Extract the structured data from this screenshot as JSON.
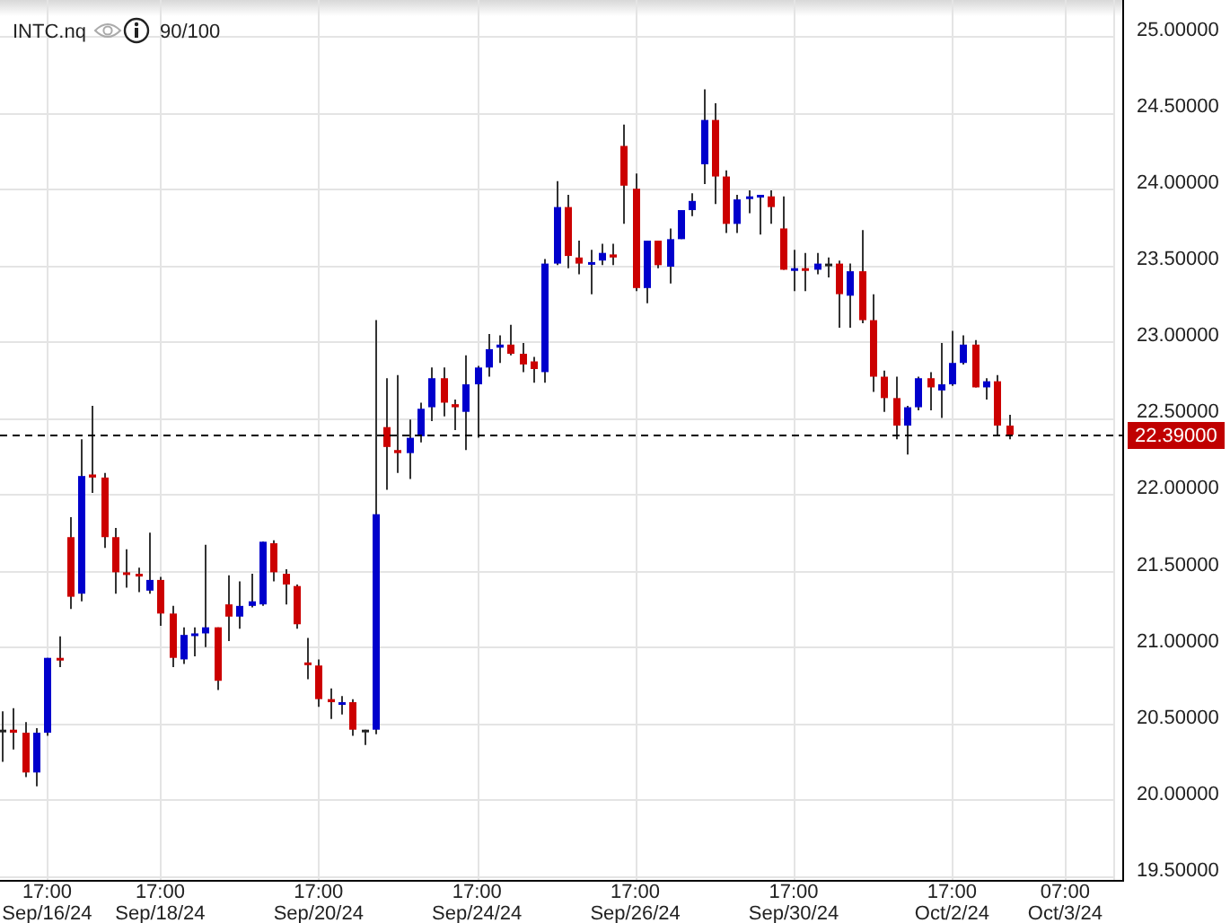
{
  "header": {
    "symbol": "INTC.nq",
    "score": "90/100"
  },
  "chart": {
    "chart_data": {
      "type": "candlestick",
      "grid": true,
      "ylim": [
        19.477,
        25.235
      ],
      "categories": [
        null,
        null,
        null,
        null,
        "17:00 Sep/16/24",
        null,
        null,
        null,
        null,
        null,
        null,
        null,
        null,
        null,
        "17:00 Sep/18/24",
        null,
        null,
        null,
        null,
        null,
        null,
        null,
        null,
        null,
        null,
        null,
        null,
        null,
        "17:00 Sep/20/24",
        null,
        null,
        null,
        null,
        null,
        null,
        null,
        null,
        null,
        null,
        null,
        null,
        null,
        "17:00 Sep/24/24",
        null,
        null,
        null,
        null,
        null,
        null,
        null,
        null,
        null,
        null,
        null,
        null,
        null,
        "17:00 Sep/26/24",
        null,
        null,
        null,
        null,
        null,
        null,
        null,
        null,
        null,
        null,
        null,
        null,
        null,
        "17:00 Sep/30/24",
        null,
        null,
        null,
        null,
        null,
        null,
        null,
        null,
        null,
        null,
        null,
        null,
        null,
        "17:00 Oct/2/24",
        null,
        null,
        null,
        null,
        null,
        null,
        null,
        null,
        null,
        "07:00 Oct/3/24"
      ],
      "ohlc": [
        [
          20.46,
          20.58,
          20.25,
          20.46
        ],
        [
          20.46,
          20.6,
          20.33,
          20.44
        ],
        [
          20.44,
          20.51,
          20.15,
          20.18
        ],
        [
          20.18,
          20.47,
          20.09,
          20.44
        ],
        [
          20.44,
          20.93,
          20.42,
          20.93
        ],
        [
          20.93,
          21.07,
          20.87,
          20.92
        ],
        [
          21.72,
          21.85,
          21.25,
          21.33
        ],
        [
          21.35,
          22.36,
          21.3,
          22.12
        ],
        [
          22.13,
          22.58,
          22.01,
          22.11
        ],
        [
          22.11,
          22.14,
          21.65,
          21.72
        ],
        [
          21.72,
          21.78,
          21.35,
          21.49
        ],
        [
          21.49,
          21.64,
          21.39,
          21.48
        ],
        [
          21.48,
          21.52,
          21.36,
          21.47
        ],
        [
          21.37,
          21.75,
          21.35,
          21.44
        ],
        [
          21.44,
          21.46,
          21.14,
          21.22
        ],
        [
          21.22,
          21.27,
          20.87,
          20.93
        ],
        [
          20.92,
          21.13,
          20.89,
          21.08
        ],
        [
          21.08,
          21.13,
          20.94,
          21.09
        ],
        [
          21.09,
          21.67,
          21.0,
          21.13
        ],
        [
          21.13,
          21.13,
          20.72,
          20.78
        ],
        [
          21.28,
          21.47,
          21.04,
          21.2
        ],
        [
          21.2,
          21.43,
          21.12,
          21.27
        ],
        [
          21.27,
          21.48,
          21.26,
          21.3
        ],
        [
          21.28,
          21.69,
          21.27,
          21.69
        ],
        [
          21.68,
          21.7,
          21.43,
          21.49
        ],
        [
          21.48,
          21.51,
          21.28,
          21.41
        ],
        [
          21.4,
          21.41,
          21.12,
          21.15
        ],
        [
          20.9,
          21.06,
          20.79,
          20.89
        ],
        [
          20.88,
          20.92,
          20.61,
          20.66
        ],
        [
          20.66,
          20.73,
          20.53,
          20.64
        ],
        [
          20.63,
          20.68,
          20.56,
          20.64
        ],
        [
          20.64,
          20.66,
          20.42,
          20.46
        ],
        [
          20.46,
          20.46,
          20.36,
          20.46
        ],
        [
          20.46,
          23.14,
          20.43,
          21.87
        ],
        [
          22.44,
          22.76,
          22.03,
          22.31
        ],
        [
          22.29,
          22.78,
          22.14,
          22.27
        ],
        [
          22.27,
          22.49,
          22.1,
          22.37
        ],
        [
          22.38,
          22.6,
          22.34,
          22.56
        ],
        [
          22.57,
          22.83,
          22.48,
          22.76
        ],
        [
          22.76,
          22.83,
          22.51,
          22.6
        ],
        [
          22.59,
          22.62,
          22.42,
          22.57
        ],
        [
          22.54,
          22.91,
          22.29,
          22.72
        ],
        [
          22.72,
          22.84,
          22.37,
          22.83
        ],
        [
          22.83,
          23.05,
          22.77,
          22.95
        ],
        [
          22.96,
          23.04,
          22.86,
          22.98
        ],
        [
          22.98,
          23.11,
          22.91,
          22.92
        ],
        [
          22.92,
          22.99,
          22.8,
          22.85
        ],
        [
          22.87,
          22.9,
          22.73,
          22.82
        ],
        [
          22.8,
          23.54,
          22.73,
          23.51
        ],
        [
          23.51,
          24.05,
          23.5,
          23.88
        ],
        [
          23.88,
          23.96,
          23.48,
          23.56
        ],
        [
          23.55,
          23.66,
          23.44,
          23.51
        ],
        [
          23.51,
          23.6,
          23.31,
          23.52
        ],
        [
          23.53,
          23.64,
          23.5,
          23.58
        ],
        [
          23.57,
          23.64,
          23.5,
          23.55
        ],
        [
          24.28,
          24.42,
          23.77,
          24.02
        ],
        [
          24.0,
          24.1,
          23.33,
          23.35
        ],
        [
          23.35,
          23.66,
          23.25,
          23.66
        ],
        [
          23.66,
          23.66,
          23.48,
          23.5
        ],
        [
          23.49,
          23.74,
          23.38,
          23.67
        ],
        [
          23.67,
          23.86,
          23.67,
          23.86
        ],
        [
          23.86,
          23.97,
          23.82,
          23.92
        ],
        [
          24.16,
          24.65,
          24.03,
          24.45
        ],
        [
          24.45,
          24.56,
          23.9,
          24.08
        ],
        [
          24.08,
          24.12,
          23.71,
          23.77
        ],
        [
          23.77,
          23.96,
          23.71,
          23.93
        ],
        [
          23.94,
          23.99,
          23.84,
          23.95
        ],
        [
          23.95,
          23.96,
          23.7,
          23.96
        ],
        [
          23.95,
          23.99,
          23.77,
          23.88
        ],
        [
          23.74,
          23.95,
          23.47,
          23.47
        ],
        [
          23.47,
          23.6,
          23.33,
          23.48
        ],
        [
          23.48,
          23.58,
          23.33,
          23.47
        ],
        [
          23.47,
          23.58,
          23.44,
          23.51
        ],
        [
          23.51,
          23.55,
          23.42,
          23.51
        ],
        [
          23.51,
          23.53,
          23.09,
          23.31
        ],
        [
          23.3,
          23.51,
          23.09,
          23.46
        ],
        [
          23.46,
          23.73,
          23.12,
          23.14
        ],
        [
          23.14,
          23.31,
          22.67,
          22.77
        ],
        [
          22.77,
          22.81,
          22.54,
          22.63
        ],
        [
          22.63,
          22.77,
          22.36,
          22.45
        ],
        [
          22.45,
          22.58,
          22.26,
          22.57
        ],
        [
          22.57,
          22.77,
          22.55,
          22.76
        ],
        [
          22.76,
          22.8,
          22.55,
          22.7
        ],
        [
          22.68,
          22.99,
          22.5,
          22.72
        ],
        [
          22.72,
          23.07,
          22.71,
          22.86
        ],
        [
          22.86,
          23.04,
          22.85,
          22.98
        ],
        [
          22.98,
          23.01,
          22.7,
          22.7
        ],
        [
          22.7,
          22.76,
          22.62,
          22.74
        ],
        [
          22.74,
          22.78,
          22.39,
          22.45
        ],
        [
          22.45,
          22.52,
          22.36,
          22.39
        ],
        null,
        null,
        null,
        null,
        null
      ],
      "yticks": [
        {
          "value": 25,
          "label": "25.00000"
        },
        {
          "value": 24.5,
          "label": "24.50000"
        },
        {
          "value": 24,
          "label": "24.00000"
        },
        {
          "value": 23.5,
          "label": "23.50000"
        },
        {
          "value": 23,
          "label": "23.00000"
        },
        {
          "value": 22.5,
          "label": "22.50000"
        },
        {
          "value": 22,
          "label": "22.00000"
        },
        {
          "value": 21.5,
          "label": "21.50000"
        },
        {
          "value": 21,
          "label": "21.00000"
        },
        {
          "value": 20.5,
          "label": "20.50000"
        },
        {
          "value": 20,
          "label": "20.00000"
        },
        {
          "value": 19.5,
          "label": "19.50000"
        }
      ],
      "ref_lines": [
        {
          "axis": "y",
          "value": 22.39,
          "label": "22.39000"
        }
      ]
    }
  }
}
